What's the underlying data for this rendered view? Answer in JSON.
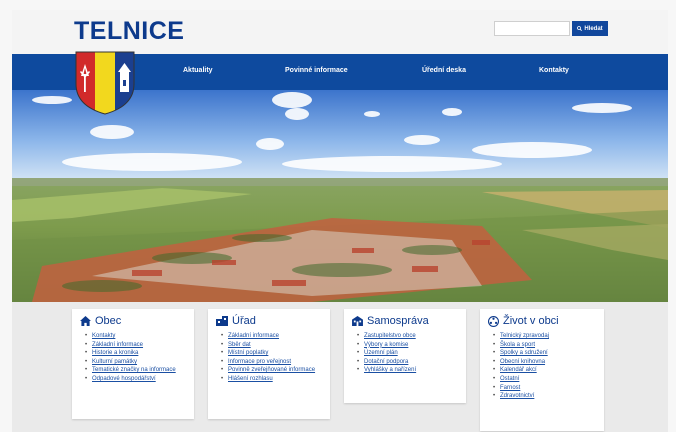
{
  "site": {
    "title": "TELNICE"
  },
  "search": {
    "placeholder": "",
    "button_label": "Hledat"
  },
  "nav": {
    "items": [
      "Aktuality",
      "Povinné informace",
      "Úřední deska",
      "Kontakty"
    ]
  },
  "colors": {
    "brand": "#0e4a9e",
    "link": "#1a4fa3",
    "crest_red": "#d12a2a",
    "crest_yellow": "#f2d81e",
    "crest_blue": "#1b3f8f"
  },
  "sections": [
    {
      "title": "Obec",
      "icon": "home-icon",
      "links": [
        "Kontakty",
        "Základní informace",
        "Historie a kronika",
        "Kulturní památky",
        "Tematické značky na informace",
        "Odpadové hospodářství"
      ]
    },
    {
      "title": "Úřad",
      "icon": "office-icon",
      "links": [
        "Základní informace",
        "Sběr dat",
        "Místní poplatky",
        "Informace pro veřejnost",
        "Povinně zveřejňované informace",
        "Hlášení rozhlasu"
      ]
    },
    {
      "title": "Samospráva",
      "icon": "town-hall-icon",
      "links": [
        "Zastupitelstvo obce",
        "Výbory a komise",
        "Územní plán",
        "Dotační podpora",
        "Vyhlášky a nařízení"
      ]
    },
    {
      "title": "Život v obci",
      "icon": "life-icon",
      "links": [
        "Telnický zpravodaj",
        "Škola a sport",
        "Spolky a sdružení",
        "Obecní knihovna",
        "Kalendář akcí",
        "Ostatní",
        "Farnost",
        "Zdravotnictví"
      ]
    }
  ]
}
